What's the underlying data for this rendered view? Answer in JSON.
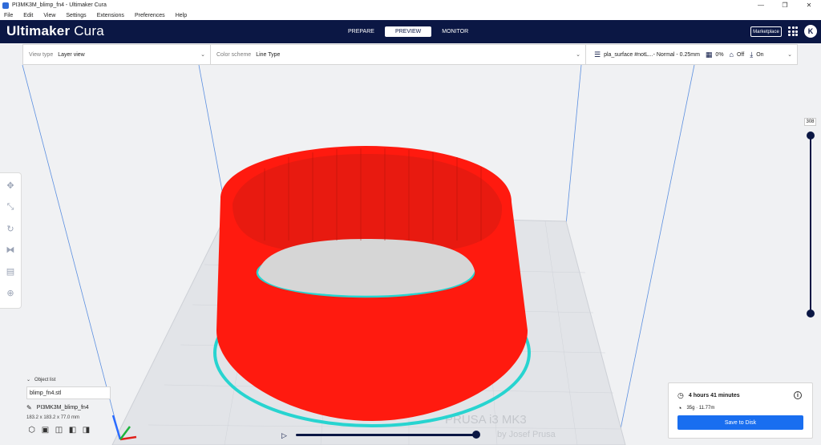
{
  "window": {
    "title": "PI3MK3M_blimp_fn4 - Ultimaker Cura",
    "min_icon": "minimize-glyph",
    "max_icon": "maximize-glyph",
    "close_icon": "close-glyph"
  },
  "menu": [
    "File",
    "Edit",
    "View",
    "Settings",
    "Extensions",
    "Preferences",
    "Help"
  ],
  "header": {
    "brand_bold": "Ultimaker",
    "brand_light": " Cura",
    "stages": [
      "PREPARE",
      "PREVIEW",
      "MONITOR"
    ],
    "active_stage": "PREVIEW",
    "marketplace": "Marketplace",
    "avatar_initial": "K"
  },
  "view_settings": {
    "view_type_label": "View type",
    "view_type_value": "Layer view",
    "color_scheme_label": "Color scheme",
    "color_scheme_value": "Line Type",
    "profile": "pla_surface #notL...- Normal - 0.25mm",
    "infill": "0%",
    "support": "Off",
    "adhesion": "On"
  },
  "object_list": {
    "header": "Object list",
    "file": "blimp_fn4.stl",
    "job_name": "PI3MK3M_blimp_fn4",
    "dimensions": "183.2 x 183.2 x 77.0 mm"
  },
  "layer_slider": {
    "top_value": "308",
    "max_fraction": 1.0,
    "min_fraction": 0.0
  },
  "simulation": {
    "progress_fraction": 1.0
  },
  "print_info": {
    "time": "4 hours 41 minutes",
    "material": "35g · 11.77m",
    "save_label": "Save to Disk"
  },
  "plate_text": {
    "line1": "PRUSA i3 MK3",
    "line2": "by Josef Prusa"
  },
  "colors": {
    "header": "#0b1744",
    "shell": "#ff1a0f",
    "skirt": "#27d4d0",
    "button": "#196ef0"
  }
}
